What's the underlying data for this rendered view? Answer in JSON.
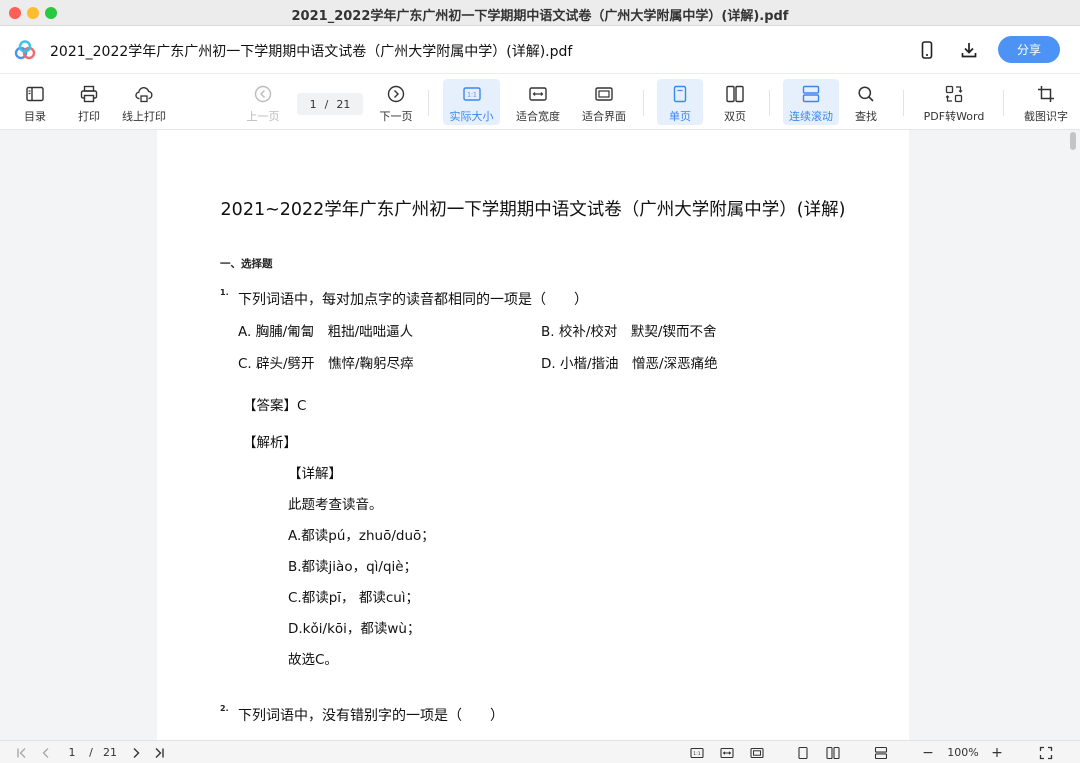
{
  "window": {
    "title": "2021_2022学年广东广州初一下学期期中语文试卷（广州大学附属中学）(详解).pdf"
  },
  "header": {
    "doc_title": "2021_2022学年广东广州初一下学期期中语文试卷（广州大学附属中学）(详解).pdf",
    "share_label": "分享",
    "accent": "#4c93f5"
  },
  "toolbar": {
    "toc": "目录",
    "print": "打印",
    "online_print": "线上打印",
    "prev_page": "上一页",
    "current_page": "1",
    "page_sep": "/",
    "total_pages": "21",
    "next_page": "下一页",
    "actual_size": "实际大小",
    "fit_width": "适合宽度",
    "fit_page": "适合界面",
    "single_page": "单页",
    "double_page": "双页",
    "continuous_scroll": "连续滚动",
    "find": "查找",
    "pdf_to_word": "PDF转Word",
    "ocr": "截图识字",
    "active_color": "#3a86f0"
  },
  "document": {
    "title": "2021~2022学年广东广州初一下学期期中语文试卷（广州大学附属中学）(详解)",
    "section": "一、选择题",
    "q1": {
      "num": "1.",
      "stem": "下列词语中，每对加点字的读音都相同的一项是（　　）",
      "opt_a": "A. 胸脯/匍匐　粗拙/咄咄逼人",
      "opt_b": "B. 校补/校对　默契/锲而不舍",
      "opt_c": "C. 辟头/劈开　憔悴/鞠躬尽瘁",
      "opt_d": "D. 小楷/揩油　憎恶/深恶痛绝",
      "answer": "【答案】C",
      "analysis": "【解析】",
      "detail": "【详解】",
      "l1": "此题考查读音。",
      "l2": "A.都读pú，zhuō/duō；",
      "l3": "B.都读jiào，qì/qiè；",
      "l4": "C.都读pī， 都读cuì；",
      "l5": "D.kǒi/kōi，都读wù；",
      "l6": "故选C。"
    },
    "q2": {
      "num": "2.",
      "stem": "下列词语中，没有错别字的一项是（　　）"
    }
  },
  "statusbar": {
    "current_page": "1",
    "page_sep": "/",
    "total_pages": "21",
    "zoom": "100%",
    "minus": "−",
    "plus": "+"
  }
}
